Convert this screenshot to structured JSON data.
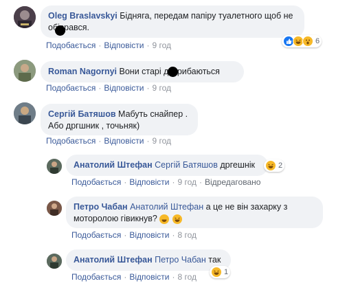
{
  "comments": [
    {
      "author": "Oleg Braslavskyi",
      "text_line1": "Бідняга, передам папіру туалетного щоб не",
      "text_line2": "обісрався.",
      "actions": {
        "like": "Подобається",
        "reply": "Відповісти",
        "time": "9 год"
      },
      "reaction_count": "6",
      "reaction_icons": [
        "like-icon",
        "haha-icon",
        "wow-icon"
      ]
    },
    {
      "author": "Roman Nagornyi",
      "text": "Вони старі дотрибаються",
      "actions": {
        "like": "Подобається",
        "reply": "Відповісти",
        "time": "9 год"
      }
    },
    {
      "author": "Сергій Батяшов",
      "text_line1": "Мабуть снайпер .",
      "text_line2": "Або дргшник , точьняк)",
      "actions": {
        "like": "Подобається",
        "reply": "Відповісти",
        "time": "9 год"
      }
    }
  ],
  "replies": [
    {
      "author": "Анатолий Штефан",
      "mention": "Сергій Батяшов",
      "text": "дргешнік",
      "reaction_count": "2",
      "actions": {
        "like": "Подобається",
        "reply": "Відповісти",
        "time": "9 год",
        "edited": "Відредаговано"
      }
    },
    {
      "author": "Петро Чабан",
      "mention": "Анатолий Штефан",
      "text_line1": "а це не він захарку з",
      "text_line2": "моторолою гівикнув?",
      "actions": {
        "like": "Подобається",
        "reply": "Відповісти",
        "time": "8 год"
      }
    },
    {
      "author": "Анатолий Штефан",
      "mention": "Петро Чабан",
      "text": "так",
      "reaction_count": "1",
      "actions": {
        "like": "Подобається",
        "reply": "Відповісти",
        "time": "8 год"
      }
    }
  ],
  "colors": {
    "bubble": "#f0f2f5",
    "link": "#385898",
    "meta": "#90949c",
    "like": "#1877f2",
    "haha": "#f7b928"
  }
}
